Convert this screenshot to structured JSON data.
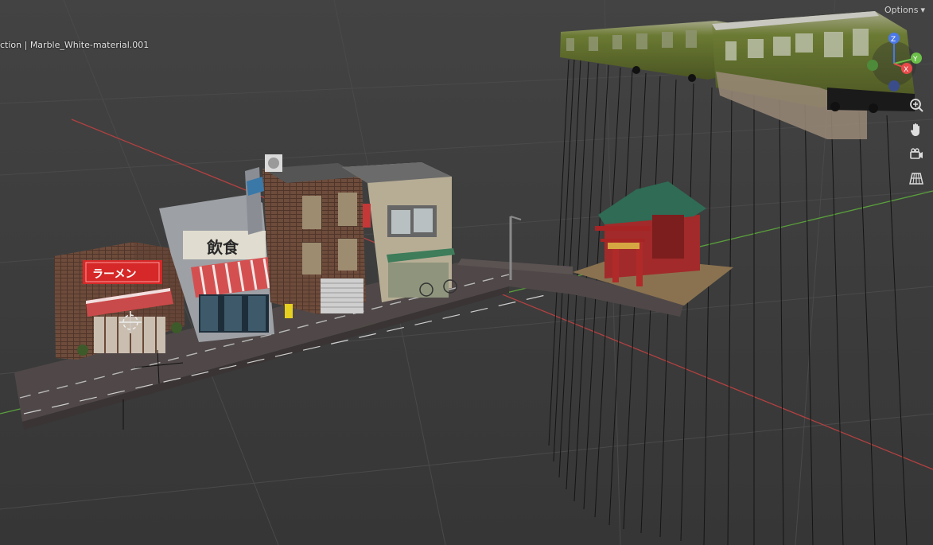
{
  "viewport": {
    "header_text": "ction | Marble_White-material.001",
    "options_label": "Options",
    "gizmo": {
      "x_label": "X",
      "y_label": "Y",
      "z_label": "Z"
    },
    "sign_ramen": "ラーメン",
    "sign_inshoku": "飲食",
    "nav_tools": [
      {
        "name": "zoom-icon"
      },
      {
        "name": "pan-hand-icon"
      },
      {
        "name": "camera-icon"
      },
      {
        "name": "grid-perspective-icon"
      }
    ]
  },
  "colors": {
    "background": "#3d3d3d",
    "axis_x": "#b34040",
    "axis_y": "#5aa03c",
    "gizmo_x": "#e84a4a",
    "gizmo_y": "#6cc04a",
    "gizmo_z": "#4a78e8"
  }
}
